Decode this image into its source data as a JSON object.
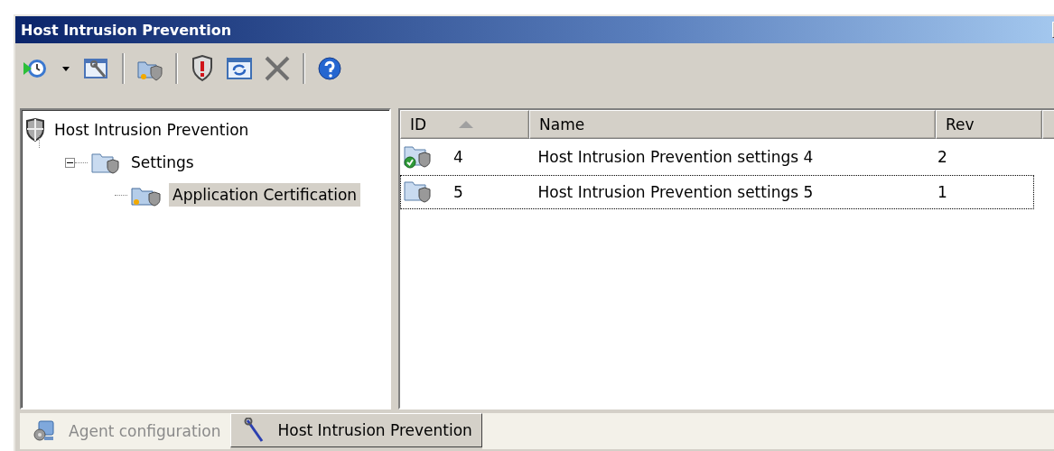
{
  "window": {
    "title": "Host Intrusion Prevention"
  },
  "tree": [
    {
      "label": "Host Intrusion Prevention",
      "kind": "shield",
      "selected": false,
      "expanded": true,
      "children": [
        {
          "label": "Settings",
          "kind": "folder",
          "selected": false,
          "expanded": true,
          "children": [
            {
              "label": "Application Certification",
              "kind": "group",
              "selected": true
            }
          ]
        }
      ]
    }
  ],
  "table": {
    "columns": [
      {
        "label": "ID",
        "sorted": true
      },
      {
        "label": "Name",
        "sorted": false
      },
      {
        "label": "Rev",
        "sorted": false
      }
    ],
    "rows": [
      {
        "id": "4",
        "name": "Host Intrusion Prevention settings 4",
        "rev": "2",
        "applied": true,
        "focused": false
      },
      {
        "id": "5",
        "name": "Host Intrusion Prevention settings 5",
        "rev": "1",
        "applied": false,
        "focused": true
      }
    ]
  },
  "tabs": [
    {
      "label": "Agent configuration",
      "kind": "agent",
      "selected": false
    },
    {
      "label": "Host Intrusion Prevention",
      "kind": "tool",
      "selected": true
    }
  ]
}
